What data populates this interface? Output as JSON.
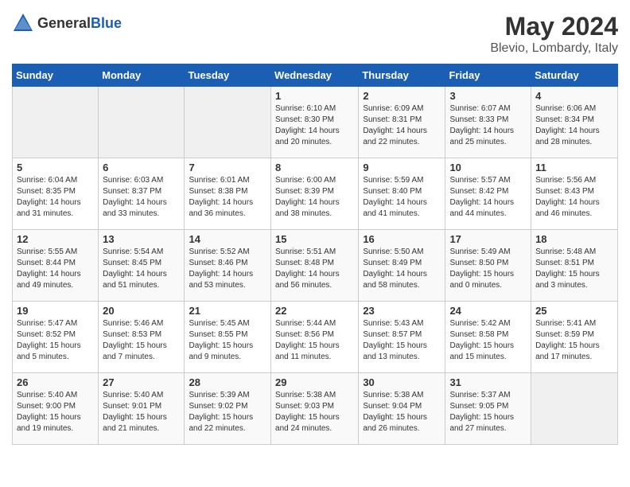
{
  "header": {
    "logo_general": "General",
    "logo_blue": "Blue",
    "title": "May 2024",
    "subtitle": "Blevio, Lombardy, Italy"
  },
  "weekdays": [
    "Sunday",
    "Monday",
    "Tuesday",
    "Wednesday",
    "Thursday",
    "Friday",
    "Saturday"
  ],
  "weeks": [
    [
      {
        "day": "",
        "info": ""
      },
      {
        "day": "",
        "info": ""
      },
      {
        "day": "",
        "info": ""
      },
      {
        "day": "1",
        "info": "Sunrise: 6:10 AM\nSunset: 8:30 PM\nDaylight: 14 hours\nand 20 minutes."
      },
      {
        "day": "2",
        "info": "Sunrise: 6:09 AM\nSunset: 8:31 PM\nDaylight: 14 hours\nand 22 minutes."
      },
      {
        "day": "3",
        "info": "Sunrise: 6:07 AM\nSunset: 8:33 PM\nDaylight: 14 hours\nand 25 minutes."
      },
      {
        "day": "4",
        "info": "Sunrise: 6:06 AM\nSunset: 8:34 PM\nDaylight: 14 hours\nand 28 minutes."
      }
    ],
    [
      {
        "day": "5",
        "info": "Sunrise: 6:04 AM\nSunset: 8:35 PM\nDaylight: 14 hours\nand 31 minutes."
      },
      {
        "day": "6",
        "info": "Sunrise: 6:03 AM\nSunset: 8:37 PM\nDaylight: 14 hours\nand 33 minutes."
      },
      {
        "day": "7",
        "info": "Sunrise: 6:01 AM\nSunset: 8:38 PM\nDaylight: 14 hours\nand 36 minutes."
      },
      {
        "day": "8",
        "info": "Sunrise: 6:00 AM\nSunset: 8:39 PM\nDaylight: 14 hours\nand 38 minutes."
      },
      {
        "day": "9",
        "info": "Sunrise: 5:59 AM\nSunset: 8:40 PM\nDaylight: 14 hours\nand 41 minutes."
      },
      {
        "day": "10",
        "info": "Sunrise: 5:57 AM\nSunset: 8:42 PM\nDaylight: 14 hours\nand 44 minutes."
      },
      {
        "day": "11",
        "info": "Sunrise: 5:56 AM\nSunset: 8:43 PM\nDaylight: 14 hours\nand 46 minutes."
      }
    ],
    [
      {
        "day": "12",
        "info": "Sunrise: 5:55 AM\nSunset: 8:44 PM\nDaylight: 14 hours\nand 49 minutes."
      },
      {
        "day": "13",
        "info": "Sunrise: 5:54 AM\nSunset: 8:45 PM\nDaylight: 14 hours\nand 51 minutes."
      },
      {
        "day": "14",
        "info": "Sunrise: 5:52 AM\nSunset: 8:46 PM\nDaylight: 14 hours\nand 53 minutes."
      },
      {
        "day": "15",
        "info": "Sunrise: 5:51 AM\nSunset: 8:48 PM\nDaylight: 14 hours\nand 56 minutes."
      },
      {
        "day": "16",
        "info": "Sunrise: 5:50 AM\nSunset: 8:49 PM\nDaylight: 14 hours\nand 58 minutes."
      },
      {
        "day": "17",
        "info": "Sunrise: 5:49 AM\nSunset: 8:50 PM\nDaylight: 15 hours\nand 0 minutes."
      },
      {
        "day": "18",
        "info": "Sunrise: 5:48 AM\nSunset: 8:51 PM\nDaylight: 15 hours\nand 3 minutes."
      }
    ],
    [
      {
        "day": "19",
        "info": "Sunrise: 5:47 AM\nSunset: 8:52 PM\nDaylight: 15 hours\nand 5 minutes."
      },
      {
        "day": "20",
        "info": "Sunrise: 5:46 AM\nSunset: 8:53 PM\nDaylight: 15 hours\nand 7 minutes."
      },
      {
        "day": "21",
        "info": "Sunrise: 5:45 AM\nSunset: 8:55 PM\nDaylight: 15 hours\nand 9 minutes."
      },
      {
        "day": "22",
        "info": "Sunrise: 5:44 AM\nSunset: 8:56 PM\nDaylight: 15 hours\nand 11 minutes."
      },
      {
        "day": "23",
        "info": "Sunrise: 5:43 AM\nSunset: 8:57 PM\nDaylight: 15 hours\nand 13 minutes."
      },
      {
        "day": "24",
        "info": "Sunrise: 5:42 AM\nSunset: 8:58 PM\nDaylight: 15 hours\nand 15 minutes."
      },
      {
        "day": "25",
        "info": "Sunrise: 5:41 AM\nSunset: 8:59 PM\nDaylight: 15 hours\nand 17 minutes."
      }
    ],
    [
      {
        "day": "26",
        "info": "Sunrise: 5:40 AM\nSunset: 9:00 PM\nDaylight: 15 hours\nand 19 minutes."
      },
      {
        "day": "27",
        "info": "Sunrise: 5:40 AM\nSunset: 9:01 PM\nDaylight: 15 hours\nand 21 minutes."
      },
      {
        "day": "28",
        "info": "Sunrise: 5:39 AM\nSunset: 9:02 PM\nDaylight: 15 hours\nand 22 minutes."
      },
      {
        "day": "29",
        "info": "Sunrise: 5:38 AM\nSunset: 9:03 PM\nDaylight: 15 hours\nand 24 minutes."
      },
      {
        "day": "30",
        "info": "Sunrise: 5:38 AM\nSunset: 9:04 PM\nDaylight: 15 hours\nand 26 minutes."
      },
      {
        "day": "31",
        "info": "Sunrise: 5:37 AM\nSunset: 9:05 PM\nDaylight: 15 hours\nand 27 minutes."
      },
      {
        "day": "",
        "info": ""
      }
    ]
  ]
}
